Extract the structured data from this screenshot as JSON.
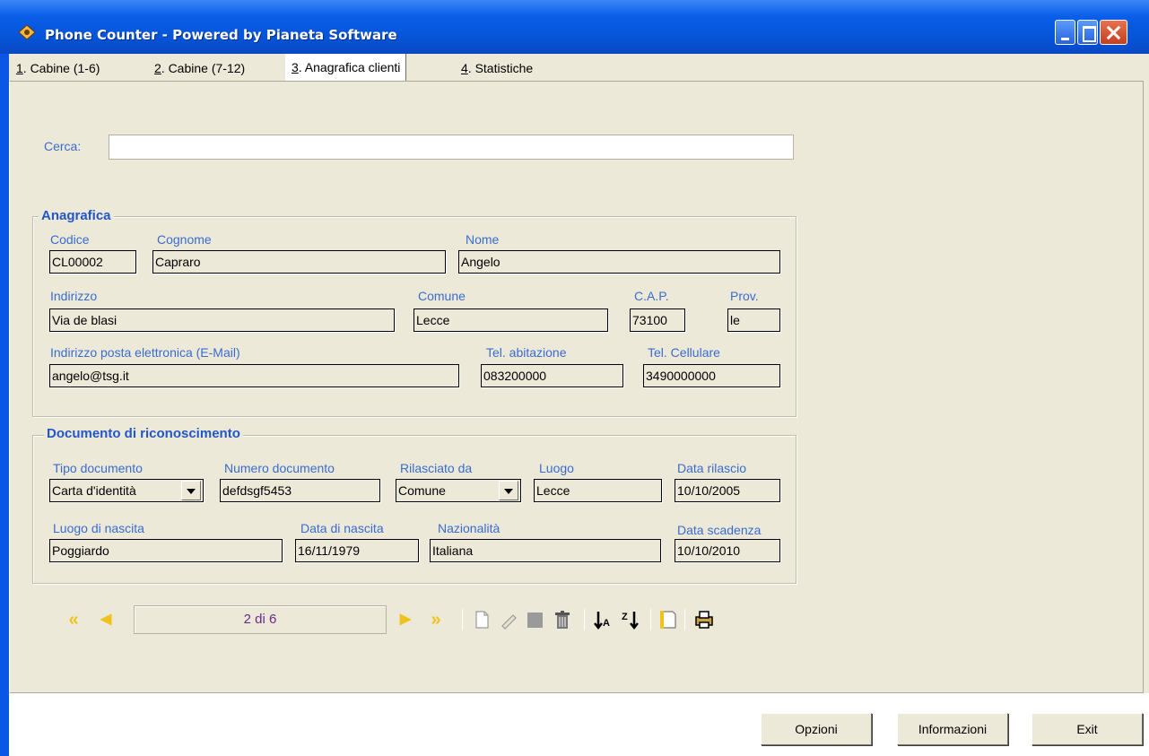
{
  "window": {
    "title": "Phone Counter - Powered by Pianeta Software"
  },
  "tabs": [
    {
      "num": "1",
      "rest": ". Cabine (1-6)"
    },
    {
      "num": "2",
      "rest": ". Cabine (7-12)"
    },
    {
      "num": "3",
      "rest": ". Anagrafica clienti"
    },
    {
      "num": "4",
      "rest": ". Statistiche"
    }
  ],
  "search": {
    "label": "Cerca:",
    "value": ""
  },
  "anagrafica": {
    "title": "Anagrafica",
    "codice": {
      "label": "Codice",
      "value": "CL00002"
    },
    "cognome": {
      "label": "Cognome",
      "value": "Capraro"
    },
    "nome": {
      "label": "Nome",
      "value": "Angelo"
    },
    "indirizzo": {
      "label": "Indirizzo",
      "value": "Via de blasi"
    },
    "comune": {
      "label": "Comune",
      "value": "Lecce"
    },
    "cap": {
      "label": "C.A.P.",
      "value": "73100"
    },
    "prov": {
      "label": "Prov.",
      "value": "le"
    },
    "email": {
      "label": "Indirizzo posta elettronica (E-Mail)",
      "value": "angelo@tsg.it"
    },
    "tel_abitazione": {
      "label": "Tel. abitazione",
      "value": "083200000"
    },
    "tel_cellulare": {
      "label": "Tel. Cellulare",
      "value": "3490000000"
    }
  },
  "documento": {
    "title": "Documento di riconoscimento",
    "tipo": {
      "label": "Tipo documento",
      "value": "Carta d'identità"
    },
    "numero": {
      "label": "Numero documento",
      "value": "defdsgf5453"
    },
    "rilasciato": {
      "label": "Rilasciato da",
      "value": "Comune"
    },
    "luogo": {
      "label": "Luogo",
      "value": "Lecce"
    },
    "data_rilascio": {
      "label": "Data rilascio",
      "value": "10/10/2005"
    },
    "luogo_nascita": {
      "label": "Luogo di nascita",
      "value": "Poggiardo"
    },
    "data_nascita": {
      "label": "Data di nascita",
      "value": "16/11/1979"
    },
    "nazionalita": {
      "label": "Nazionalità",
      "value": "Italiana"
    },
    "data_scadenza": {
      "label": "Data scadenza",
      "value": "10/10/2010"
    }
  },
  "navigator": {
    "record_indicator": "2 di 6",
    "first_glyph": "«",
    "prev_glyph": "◀",
    "next_glyph": "▶",
    "last_glyph": "»",
    "icons": [
      "new-record-icon",
      "edit-record-icon",
      "save-record-icon",
      "delete-record-icon",
      "sort-ascending-icon",
      "sort-descending-icon",
      "bookmark-icon",
      "print-icon"
    ]
  },
  "buttons": {
    "opzioni": "Opzioni",
    "informazioni": "Informazioni",
    "exit": "Exit"
  },
  "colors": {
    "title_bar": "#0a5ee8",
    "label": "#3a6ccf",
    "group_title": "#2356c7",
    "nav_arrow": "#f2c21c",
    "face": "#ece9d8"
  }
}
